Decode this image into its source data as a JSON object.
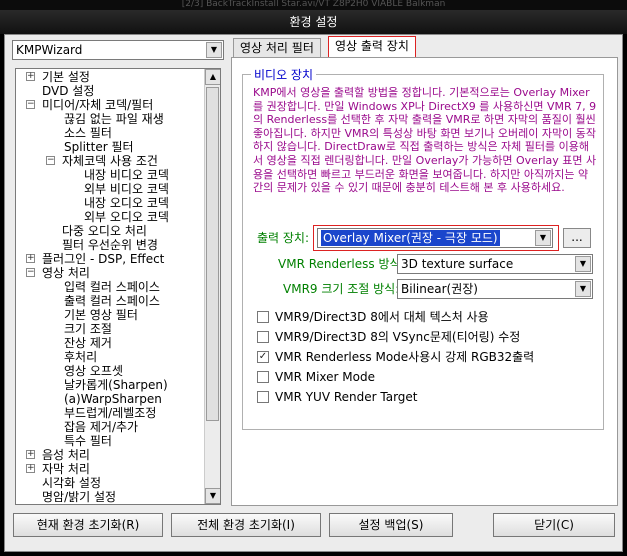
{
  "window": {
    "top_strip": "[2/3] BackTrackInstall Star.avi/VT  Z8P2H0 VIABLE Balkman",
    "title": "환경 설정"
  },
  "profile_combo": {
    "value": "KMPWizard"
  },
  "tree": {
    "items": [
      {
        "label": "기본 설정",
        "expander": "+"
      },
      {
        "label": "DVD 설정",
        "expander": ""
      },
      {
        "label": "미디어/자체 코덱/필터",
        "expander": "−"
      },
      {
        "label": "끊김 없는 파일 재생",
        "expander": ""
      },
      {
        "label": "소스 필터",
        "expander": ""
      },
      {
        "label": "Splitter 필터",
        "expander": ""
      },
      {
        "label": "자체코덱 사용 조건",
        "expander": "−"
      },
      {
        "label": "내장 비디오 코덱",
        "expander": ""
      },
      {
        "label": "외부 비디오 코덱",
        "expander": ""
      },
      {
        "label": "내장 오디오 코덱",
        "expander": ""
      },
      {
        "label": "외부 오디오 코덱",
        "expander": ""
      },
      {
        "label": "다중 오디오 처리",
        "expander": ""
      },
      {
        "label": "필터 우선순위 변경",
        "expander": ""
      },
      {
        "label": "플러그인 - DSP, Effect",
        "expander": "+"
      },
      {
        "label": "영상 처리",
        "expander": "−"
      },
      {
        "label": "입력 컬러 스페이스",
        "expander": ""
      },
      {
        "label": "출력 컬러 스페이스",
        "expander": ""
      },
      {
        "label": "기본 영상 필터",
        "expander": ""
      },
      {
        "label": "크기 조절",
        "expander": ""
      },
      {
        "label": "잔상 제거",
        "expander": ""
      },
      {
        "label": "후처리",
        "expander": ""
      },
      {
        "label": "영상 오프셋",
        "expander": ""
      },
      {
        "label": "날카롭게(Sharpen)",
        "expander": ""
      },
      {
        "label": "(a)WarpSharpen",
        "expander": ""
      },
      {
        "label": "부드럽게/레벨조정",
        "expander": ""
      },
      {
        "label": "잡음 제거/추가",
        "expander": ""
      },
      {
        "label": "특수 필터",
        "expander": ""
      },
      {
        "label": "음성 처리",
        "expander": "+"
      },
      {
        "label": "자막 처리",
        "expander": "+"
      },
      {
        "label": "시각화 설정",
        "expander": ""
      },
      {
        "label": "명암/밝기 설정",
        "expander": ""
      }
    ]
  },
  "tabs": [
    {
      "label": "영상 처리 필터"
    },
    {
      "label": "영상 출력 장치"
    }
  ],
  "group": {
    "title": "비디오 장치",
    "description": "KMP에서 영상을 출력할 방법을 정합니다. 기본적으로는 Overlay Mixer를 권장합니다. 만일 Windows XP나 DirectX9 를 사용하신면 VMR 7, 9의 Renderless를 선택한 후 자막 출력을 VMR로 하면 자막의 품질이 훨씬 좋아집니다. 하지만 VMR의 특성상 바탕 화면 보기나 오버레이 자막이 동작하지 않습니다. DirectDraw로 직접 출력하는 방식은 자체 필터를 이용해서 영상을 직접 렌더링합니다. 만일 Overlay가 가능하면 Overlay 표면 사용을 선택하면 빠르고 부드러운 화면을 보여줍니다. 하지만 아직까지는 약간의 문제가 있을 수 있기 때문에 충분히 테스트해 본 후 사용하세요."
  },
  "output_device": {
    "label": "출력 장치:",
    "value": "Overlay Mixer(권장 - 극장 모드)",
    "more_button": "..."
  },
  "vmr_renderless": {
    "label": "VMR Renderless 방식:",
    "value": "3D texture surface"
  },
  "vmr9_resize": {
    "label": "VMR9 크기 조절 방식:",
    "value": "Bilinear(권장)"
  },
  "checkboxes": [
    {
      "label": "VMR9/Direct3D 8에서 대체 텍스처 사용",
      "checked": false
    },
    {
      "label": "VMR9/Direct3D 8의 VSync문제(티어링) 수정",
      "checked": false
    },
    {
      "label": "VMR Renderless Mode사용시 강제 RGB32출력",
      "checked": true
    },
    {
      "label": "VMR Mixer Mode",
      "checked": false
    },
    {
      "label": "VMR YUV Render Target",
      "checked": false
    }
  ],
  "buttons": {
    "reset_current": "현재 환경 초기화(R)",
    "reset_all": "전체 환경 초기화(I)",
    "backup": "설정 백업(S)",
    "close": "닫기(C)"
  },
  "colors": {
    "description_text": "#9a0a8c",
    "field_label": "#008000",
    "group_title": "#0000cc",
    "highlight": "#1a46cc",
    "annotation_box": "#dd2222"
  }
}
